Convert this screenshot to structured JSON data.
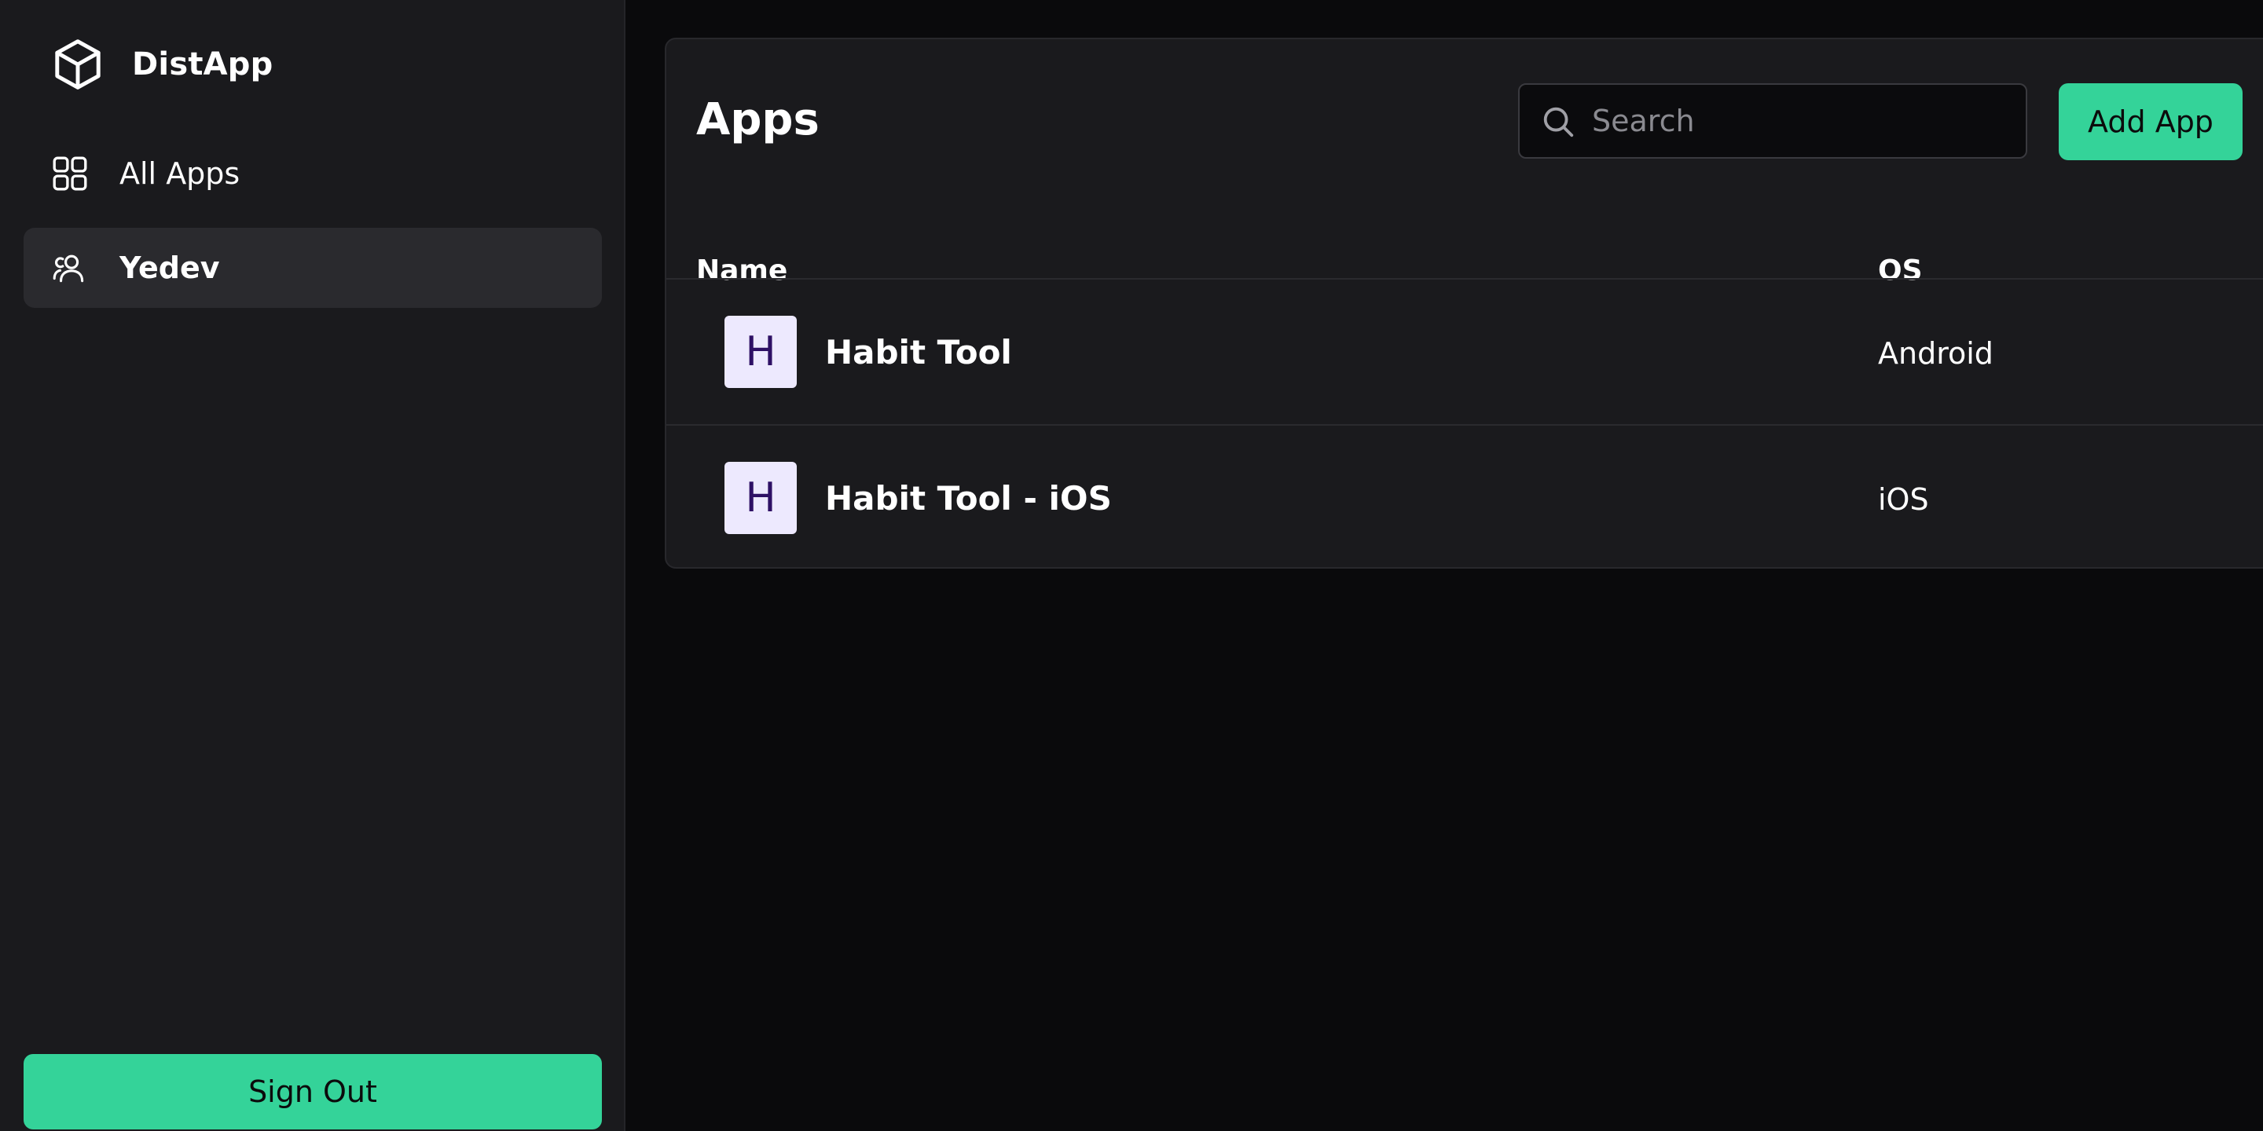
{
  "sidebar": {
    "brand_name": "DistApp",
    "items": [
      {
        "label": "All Apps",
        "icon": "grid-icon"
      },
      {
        "label": "Yedev",
        "icon": "users-icon",
        "selected": true
      }
    ],
    "sign_out_label": "Sign Out"
  },
  "main": {
    "title": "Apps",
    "search": {
      "placeholder": "Search",
      "value": ""
    },
    "add_label": "Add App",
    "columns": [
      "Name",
      "OS"
    ],
    "rows": [
      {
        "initial": "H",
        "name": "Habit Tool",
        "os": "Android"
      },
      {
        "initial": "H",
        "name": "Habit Tool - iOS",
        "os": "iOS"
      }
    ]
  },
  "colors": {
    "accent": "#34d399",
    "sidebar_bg": "#1a1a1d",
    "page_bg": "#0a0a0c",
    "avatar_bg": "#ede9fe",
    "avatar_text": "#2e1065"
  }
}
